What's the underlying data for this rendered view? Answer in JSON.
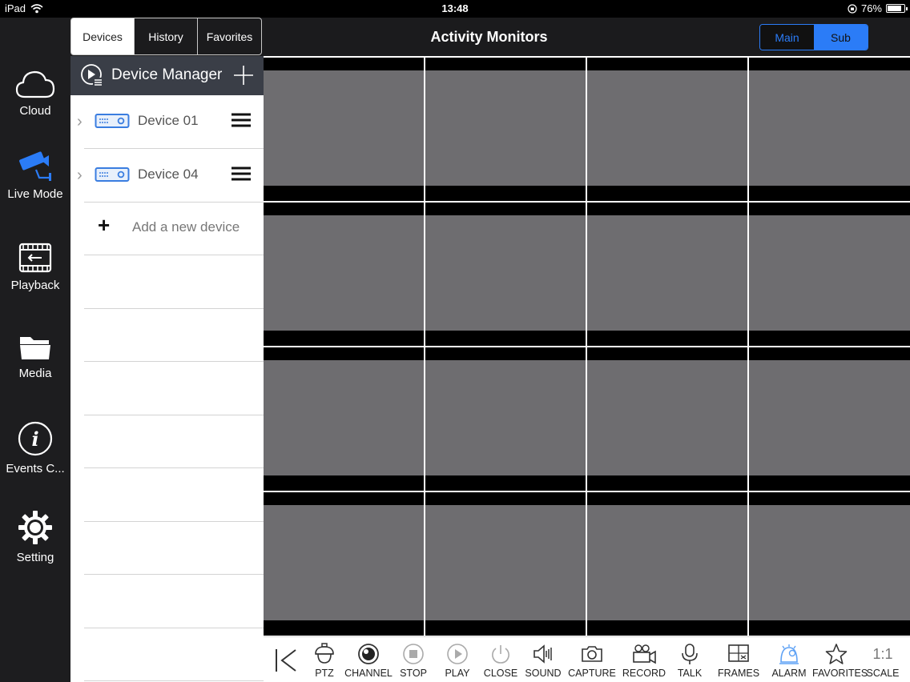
{
  "status_bar": {
    "device": "iPad",
    "time": "13:48",
    "battery": "76%",
    "battery_level": 0.76
  },
  "nav": {
    "items": [
      {
        "label": "Cloud",
        "icon": "cloud-icon"
      },
      {
        "label": "Live Mode",
        "icon": "cctv-camera-icon"
      },
      {
        "label": "Playback",
        "icon": "film-playback-icon"
      },
      {
        "label": "Media",
        "icon": "folder-icon"
      },
      {
        "label": "Events C...",
        "icon": "info-icon"
      },
      {
        "label": "Setting",
        "icon": "gear-icon"
      }
    ],
    "active": "Live Mode"
  },
  "tabs": [
    {
      "label": "Devices",
      "active": true
    },
    {
      "label": "History",
      "active": false
    },
    {
      "label": "Favorites",
      "active": false
    }
  ],
  "device_manager": {
    "title": "Device Manager",
    "devices": [
      {
        "name": "Device 01"
      },
      {
        "name": "Device 04"
      }
    ],
    "add_label": "Add a new device"
  },
  "header": {
    "title": "Activity Monitors",
    "stream_main": "Main",
    "stream_sub": "Sub",
    "stream_selected": "Sub"
  },
  "toolbar": {
    "buttons": [
      {
        "label": "PTZ",
        "icon": "ptz-dome-icon"
      },
      {
        "label": "CHANNEL",
        "icon": "channel-lens-icon"
      },
      {
        "label": "STOP",
        "icon": "stop-icon"
      },
      {
        "label": "PLAY",
        "icon": "play-icon"
      },
      {
        "label": "CLOSE",
        "icon": "power-icon"
      },
      {
        "label": "SOUND",
        "icon": "speaker-icon"
      },
      {
        "label": "CAPTURE",
        "icon": "camera-icon"
      },
      {
        "label": "RECORD",
        "icon": "video-camera-icon"
      },
      {
        "label": "TALK",
        "icon": "microphone-icon"
      },
      {
        "label": "FRAMES",
        "icon": "frames-icon"
      },
      {
        "label": "ALARM",
        "icon": "alarm-icon"
      },
      {
        "label": "FAVORITES",
        "icon": "star-icon"
      },
      {
        "label": "SCALE",
        "icon": "scale-icon",
        "glyph": "1:1"
      }
    ]
  },
  "colors": {
    "accent": "#2b7cf7",
    "video_placeholder": "#6e6d70",
    "panel_header": "#3a3e47"
  }
}
